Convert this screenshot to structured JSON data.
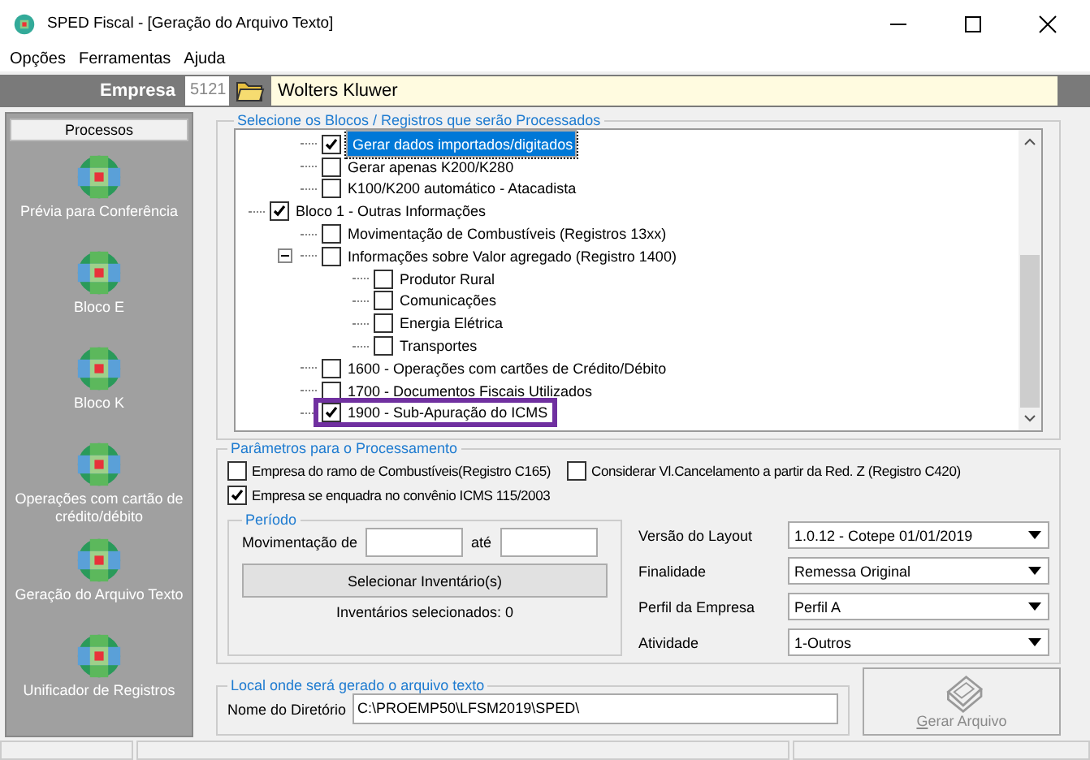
{
  "window": {
    "title": "SPED Fiscal - [Geração do Arquivo Texto]"
  },
  "menu": [
    "Opções",
    "Ferramentas",
    "Ajuda"
  ],
  "empresa": {
    "label": "Empresa",
    "code": "5121",
    "name": "Wolters Kluwer"
  },
  "sidebar": {
    "title": "Processos",
    "items": [
      {
        "label": "Prévia para Conferência"
      },
      {
        "label": "Bloco E"
      },
      {
        "label": "Bloco K"
      },
      {
        "label": "Operações com cartão de crédito/débito"
      },
      {
        "label": "Geração do Arquivo Texto"
      },
      {
        "label": "Unificador de Registros"
      }
    ]
  },
  "blocks": {
    "title": "Selecione os Blocos / Registros que serão Processados",
    "continued_children": [
      {
        "label": "Gerar dados importados/digitados",
        "checked": true,
        "selected": true,
        "marked": false
      },
      {
        "label": "Gerar apenas K200/K280",
        "checked": false,
        "selected": false,
        "marked": false
      },
      {
        "label": "K100/K200 automático - Atacadista",
        "checked": false,
        "selected": false,
        "marked": false
      }
    ],
    "items": [
      {
        "label": "Bloco 1 - Outras Informações",
        "checked": true,
        "selected": false,
        "marked": false,
        "children": [
          {
            "label": "Movimentação de Combustíveis (Registros 13xx)",
            "checked": false,
            "selected": false,
            "marked": false
          },
          {
            "label": "Informações sobre Valor agregado (Registro 1400)",
            "checked": false,
            "selected": false,
            "marked": false,
            "expanded": true,
            "children": [
              {
                "label": "Produtor Rural",
                "checked": false,
                "selected": false,
                "marked": false
              },
              {
                "label": "Comunicações",
                "checked": false,
                "selected": false,
                "marked": false
              },
              {
                "label": "Energia Elétrica",
                "checked": false,
                "selected": false,
                "marked": false
              },
              {
                "label": "Transportes",
                "checked": false,
                "selected": false,
                "marked": false
              }
            ]
          },
          {
            "label": "1600 - Operações com cartões de Crédito/Débito",
            "checked": false,
            "selected": false,
            "marked": false
          },
          {
            "label": "1700 - Documentos Fiscais Utilizados",
            "checked": false,
            "selected": false,
            "marked": false
          },
          {
            "label": "1900 - Sub-Apuração do ICMS",
            "checked": true,
            "selected": false,
            "marked": true
          }
        ]
      }
    ]
  },
  "params": {
    "title": "Parâmetros para o Processamento",
    "options": [
      {
        "label": "Empresa do ramo de Combustíveis(Registro C165)",
        "checked": false
      },
      {
        "label": "Considerar Vl.Cancelamento a partir da Red. Z (Registro C420)",
        "checked": false
      },
      {
        "label": "Empresa se enquadra no convênio ICMS 115/2003",
        "checked": true
      }
    ],
    "periodo": {
      "title": "Período",
      "from_label": "Movimentação de",
      "to_label": "até",
      "button": "Selecionar Inventário(s)",
      "info": "Inventários selecionados: 0"
    },
    "selects": [
      {
        "label": "Versão do Layout",
        "value": "1.0.12 - Cotepe 01/01/2019"
      },
      {
        "label": "Finalidade",
        "value": "Remessa Original"
      },
      {
        "label": "Perfil da Empresa",
        "value": "Perfil A"
      },
      {
        "label": "Atividade",
        "value": "1-Outros"
      }
    ]
  },
  "local": {
    "title": "Local onde será gerado o arquivo texto",
    "label": "Nome do Diretório",
    "value": "C:\\PROEMP50\\LFSM2019\\SPED\\"
  },
  "generate": {
    "label": "Gerar Arquivo",
    "disabled": true
  }
}
